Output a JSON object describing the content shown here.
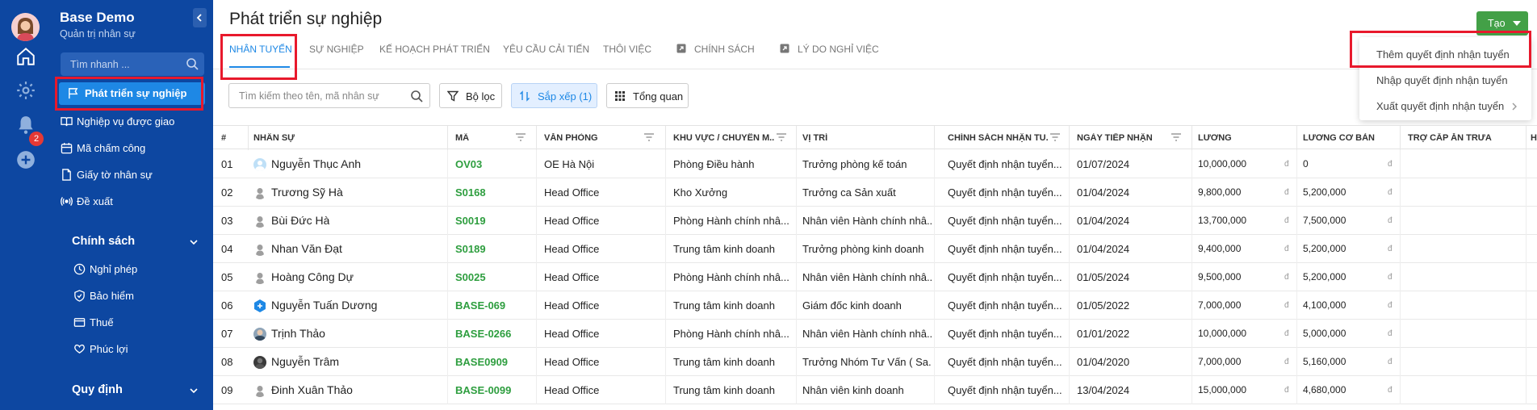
{
  "sidebar": {
    "title": "Base Demo",
    "subtitle": "Quản trị nhân sự",
    "search_placeholder": "Tìm nhanh ...",
    "active_item": "Phát triển sự nghiệp",
    "items": [
      "Nghiệp vụ được giao",
      "Mã chấm công",
      "Giấy tờ nhân sự",
      "Đề xuất"
    ],
    "section_policy": "Chính sách",
    "policy_items": [
      "Nghỉ phép",
      "Bảo hiểm",
      "Thuế",
      "Phúc lợi"
    ],
    "section_rules": "Quy định"
  },
  "rail": {
    "notification_count": "2"
  },
  "page": {
    "title": "Phát triển sự nghiệp",
    "tabs": [
      "NHÂN TUYỂN",
      "SỰ NGHIỆP",
      "KẾ HOẠCH PHÁT TRIỂN",
      "YÊU CẦU CẢI TIẾN",
      "THÔI VIỆC",
      "CHÍNH SÁCH",
      "LÝ DO NGHỈ VIỆC"
    ]
  },
  "create_button": {
    "label": "Tạo"
  },
  "create_menu": [
    "Thêm quyết định nhận tuyển",
    "Nhập quyết định nhận tuyển",
    "Xuất quyết định nhận tuyển"
  ],
  "toolbar": {
    "search_placeholder": "Tìm kiếm theo tên, mã nhân sự",
    "filter_label": "Bộ lọc",
    "sort_label": "Sắp xếp (1)",
    "overview_label": "Tổng quan"
  },
  "table": {
    "columns": [
      "#",
      "NHÂN SỰ",
      "MÃ",
      "VĂN PHÒNG",
      "KHU VỰC / CHUYÊN M...",
      "VỊ TRÍ",
      "CHÍNH SÁCH NHẬN TU...",
      "NGÀY TIẾP NHẬN",
      "LƯƠNG",
      "LƯƠNG CƠ BẢN",
      "TRỢ CẤP ĂN TRƯA",
      "H"
    ],
    "currency_symbol": "đ",
    "rows": [
      {
        "no": "01",
        "name": "Nguyễn Thục Anh",
        "code": "OV03",
        "office": "OE Hà Nội",
        "area": "Phòng Điều hành",
        "position": "Trưởng phòng kế toán",
        "policy": "Quyết định nhận tuyển...",
        "date": "01/07/2024",
        "salary": "10,000,000",
        "base_salary": "0",
        "avatar": "person-blue"
      },
      {
        "no": "02",
        "name": "Trương Sỹ Hà",
        "code": "S0168",
        "office": "Head Office",
        "area": "Kho Xưởng",
        "position": "Trưởng ca Sản xuất",
        "policy": "Quyết định nhận tuyển...",
        "date": "01/04/2024",
        "salary": "9,800,000",
        "base_salary": "5,200,000",
        "avatar": "person-gray"
      },
      {
        "no": "03",
        "name": "Bùi Đức Hà",
        "code": "S0019",
        "office": "Head Office",
        "area": "Phòng Hành chính nhâ...",
        "position": "Nhân viên Hành chính nhâ...",
        "policy": "Quyết định nhận tuyển...",
        "date": "01/04/2024",
        "salary": "13,700,000",
        "base_salary": "7,500,000",
        "avatar": "person-gray"
      },
      {
        "no": "04",
        "name": "Nhan Văn Đạt",
        "code": "S0189",
        "office": "Head Office",
        "area": "Trung tâm kinh doanh",
        "position": "Trưởng phòng kinh doanh",
        "policy": "Quyết định nhận tuyển...",
        "date": "01/04/2024",
        "salary": "9,400,000",
        "base_salary": "5,200,000",
        "avatar": "person-gray"
      },
      {
        "no": "05",
        "name": "Hoàng Công Dự",
        "code": "S0025",
        "office": "Head Office",
        "area": "Phòng Hành chính nhâ...",
        "position": "Nhân viên Hành chính nhâ...",
        "policy": "Quyết định nhận tuyển...",
        "date": "01/05/2024",
        "salary": "9,500,000",
        "base_salary": "5,200,000",
        "avatar": "person-gray"
      },
      {
        "no": "06",
        "name": "Nguyễn Tuấn Dương",
        "code": "BASE-069",
        "office": "Head Office",
        "area": "Trung tâm kinh doanh",
        "position": "Giám đốc kinh doanh",
        "policy": "Quyết định nhận tuyển...",
        "date": "01/05/2022",
        "salary": "7,000,000",
        "base_salary": "4,100,000",
        "avatar": "hex-blue"
      },
      {
        "no": "07",
        "name": "Trịnh Thảo",
        "code": "BASE-0266",
        "office": "Head Office",
        "area": "Phòng Hành chính nhâ...",
        "position": "Nhân viên Hành chính nhâ...",
        "policy": "Quyết định nhận tuyển...",
        "date": "01/01/2022",
        "salary": "10,000,000",
        "base_salary": "5,000,000",
        "avatar": "photo"
      },
      {
        "no": "08",
        "name": "Nguyễn Trâm",
        "code": "BASE0909",
        "office": "Head Office",
        "area": "Trung tâm kinh doanh",
        "position": "Trưởng Nhóm Tư Vấn ( Sa...",
        "policy": "Quyết định nhận tuyển...",
        "date": "01/04/2020",
        "salary": "7,000,000",
        "base_salary": "5,160,000",
        "avatar": "photo-dark"
      },
      {
        "no": "09",
        "name": "Đinh Xuân Thảo",
        "code": "BASE-0099",
        "office": "Head Office",
        "area": "Trung tâm kinh doanh",
        "position": "Nhân viên kinh doanh",
        "policy": "Quyết định nhận tuyển...",
        "date": "13/04/2024",
        "salary": "15,000,000",
        "base_salary": "4,680,000",
        "avatar": "person-gray"
      }
    ]
  },
  "colors": {
    "sidebar_bg": "#0d47a1",
    "active_item_bg": "#1e88e5",
    "accent": "#1e88e5",
    "create_button": "#43a047",
    "code_text": "#2e9e3f",
    "highlight_box": "#e8192c",
    "badge": "#e53935"
  }
}
